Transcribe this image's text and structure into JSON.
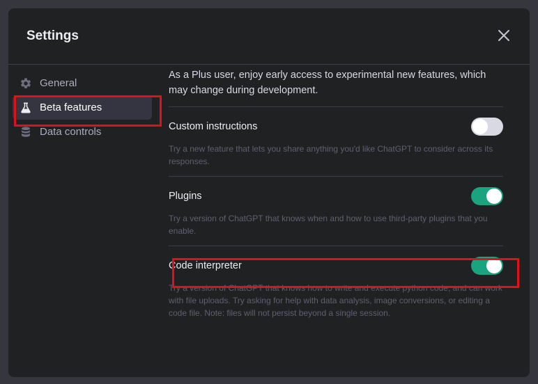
{
  "dialog": {
    "title": "Settings",
    "close_icon": "close-icon"
  },
  "sidebar": {
    "items": [
      {
        "label": "General",
        "icon": "gear-icon",
        "active": false
      },
      {
        "label": "Beta features",
        "icon": "flask-icon",
        "active": true
      },
      {
        "label": "Data controls",
        "icon": "database-icon",
        "active": false
      }
    ]
  },
  "main": {
    "intro": "As a Plus user, enjoy early access to experimental new features, which may change during development.",
    "features": [
      {
        "label": "Custom instructions",
        "enabled": false,
        "description": "Try a new feature that lets you share anything you'd like ChatGPT to consider across its responses."
      },
      {
        "label": "Plugins",
        "enabled": true,
        "description": "Try a version of ChatGPT that knows when and how to use third-party plugins that you enable."
      },
      {
        "label": "Code interpreter",
        "enabled": true,
        "description": "Try a version of ChatGPT that knows how to write and execute python code, and can work with file uploads. Try asking for help with data analysis, image conversions, or editing a code file. Note: files will not persist beyond a single session."
      }
    ]
  },
  "colors": {
    "accent_toggle_on": "#19a37f",
    "highlight_box": "#e0111b",
    "modal_bg": "#202123"
  }
}
